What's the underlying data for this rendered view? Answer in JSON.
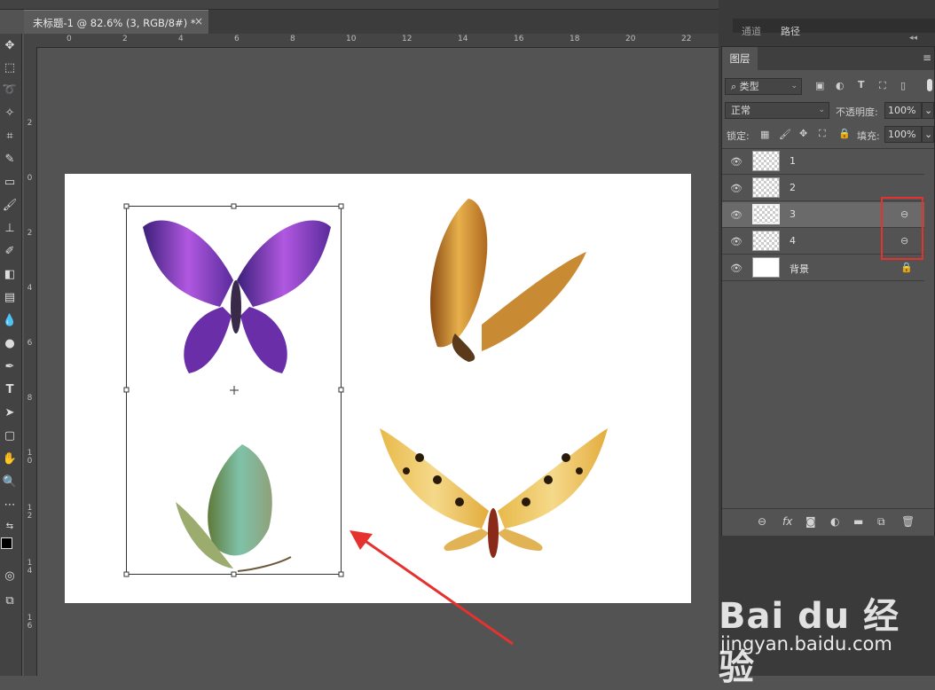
{
  "document_tab": {
    "label": "未标题-1 @ 82.6% (3, RGB/8#) *",
    "close": "×"
  },
  "ruler_top": [
    "0",
    "2",
    "4",
    "6",
    "8",
    "10",
    "12",
    "14",
    "16",
    "18",
    "20",
    "22"
  ],
  "ruler_left": [
    "2",
    "0",
    "2",
    "4",
    "6",
    "8",
    "1\n0",
    "1\n2",
    "1\n4",
    "1\n6"
  ],
  "dock_tabs": [
    "通道",
    "路径"
  ],
  "layers_panel": {
    "title": "图层",
    "filter_kind": "类型",
    "blend_mode": "正常",
    "opacity_label": "不透明度:",
    "opacity_value": "100%",
    "lock_label": "锁定:",
    "fill_label": "填充:",
    "fill_value": "100%",
    "layers": [
      {
        "name": "1",
        "active": false,
        "linked": false,
        "locked": false
      },
      {
        "name": "2",
        "active": false,
        "linked": false,
        "locked": false
      },
      {
        "name": "3",
        "active": true,
        "linked": true,
        "locked": false
      },
      {
        "name": "4",
        "active": false,
        "linked": true,
        "locked": false
      },
      {
        "name": "背景",
        "active": false,
        "linked": false,
        "locked": true
      }
    ]
  },
  "watermark": {
    "line1": "Bai du 经验",
    "line2": "jingyan.baidu.com"
  },
  "colors": {
    "highlight": "#e5322e",
    "panel": "#535353",
    "canvas": "#ffffff"
  }
}
